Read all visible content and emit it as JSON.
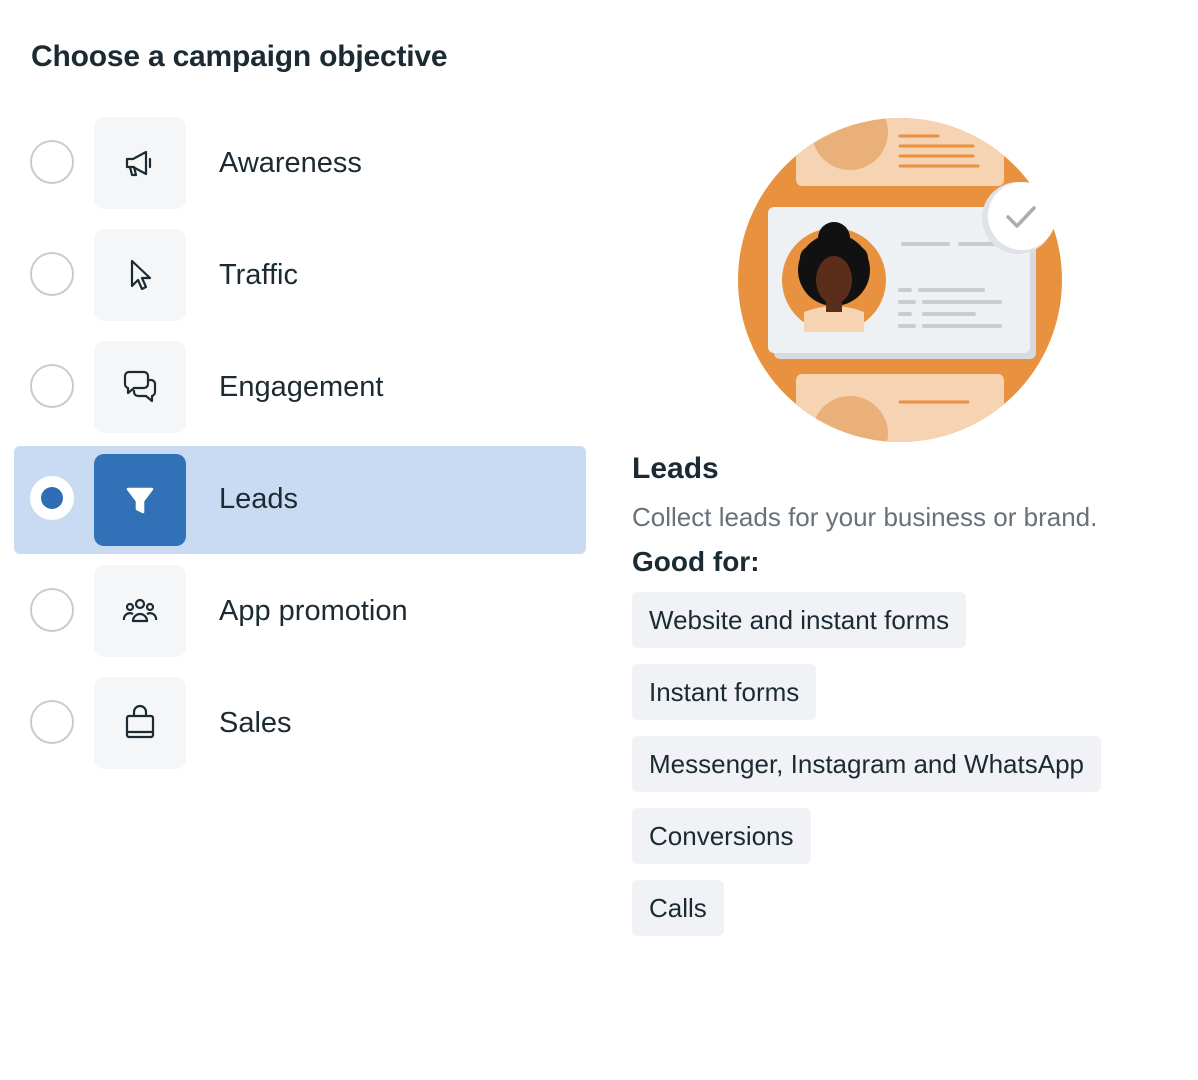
{
  "page_title": "Choose a campaign objective",
  "objectives": [
    {
      "label": "Awareness",
      "icon": "megaphone-icon",
      "selected": false
    },
    {
      "label": "Traffic",
      "icon": "cursor-icon",
      "selected": false
    },
    {
      "label": "Engagement",
      "icon": "chat-bubbles-icon",
      "selected": false
    },
    {
      "label": "Leads",
      "icon": "funnel-icon",
      "selected": true
    },
    {
      "label": "App promotion",
      "icon": "people-icon",
      "selected": false
    },
    {
      "label": "Sales",
      "icon": "shopping-bag-icon",
      "selected": false
    }
  ],
  "detail": {
    "title": "Leads",
    "description": "Collect leads for your business or brand.",
    "good_for_label": "Good for:",
    "good_for": [
      "Website and instant forms",
      "Instant forms",
      "Messenger, Instagram and WhatsApp",
      "Conversions",
      "Calls"
    ]
  },
  "colors": {
    "selected_row_bg": "#c9dbf2",
    "selected_icon_bg": "#3171b8",
    "radio_selected": "#2f6db5",
    "illustration_orange": "#e8913f",
    "illustration_peach": "#f5d3b3"
  }
}
